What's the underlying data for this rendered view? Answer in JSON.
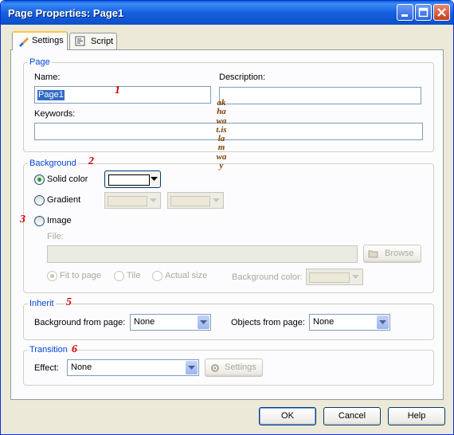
{
  "window": {
    "title": "Page Properties: Page1"
  },
  "tabs": [
    {
      "label": "Settings",
      "icon": "brush-icon"
    },
    {
      "label": "Script",
      "icon": "script-icon"
    }
  ],
  "page_group": {
    "legend": "Page",
    "name_label": "Name:",
    "name_value": "Page1",
    "description_label": "Description:",
    "description_value": "",
    "keywords_label": "Keywords:",
    "keywords_value": ""
  },
  "background_group": {
    "legend": "Background",
    "solid_color_label": "Solid color",
    "gradient_label": "Gradient",
    "image_label": "Image",
    "file_label": "File:",
    "browse_label": "Browse",
    "fit_to_page_label": "Fit to page",
    "tile_label": "Tile",
    "actual_size_label": "Actual size",
    "background_color_label": "Background color:",
    "selected": "Solid color",
    "solid_color_value": "#ffffff"
  },
  "inherit_group": {
    "legend": "Inherit",
    "background_from_page_label": "Background from page:",
    "background_from_page_value": "None",
    "objects_from_page_label": "Objects from page:",
    "objects_from_page_value": "None"
  },
  "transition_group": {
    "legend": "Transition",
    "effect_label": "Effect:",
    "effect_value": "None",
    "settings_label": "Settings"
  },
  "footer": {
    "ok_label": "OK",
    "cancel_label": "Cancel",
    "help_label": "Help"
  },
  "annotations": {
    "n1": "1",
    "n2": "2",
    "n3": "3",
    "n5": "5",
    "n6": "6",
    "vertical_text": "akhawat.islamway"
  },
  "colors": {
    "title_bar": "#0a5fd8",
    "accent": "#0046d5",
    "annotation": "#d40000"
  }
}
